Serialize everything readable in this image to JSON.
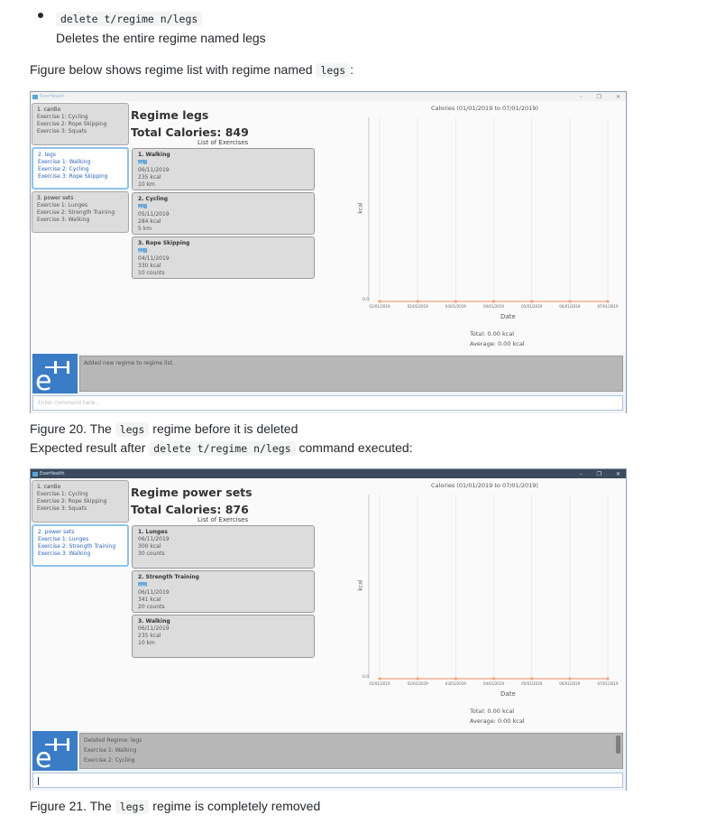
{
  "intro": {
    "command": "delete t/regime n/legs",
    "description": "Deletes the entire regime named legs",
    "figure_intro_prefix": "Figure below shows regime list with regime named",
    "figure_intro_code": "legs",
    "figure_intro_suffix": ":"
  },
  "window1": {
    "app_title": "ExerHealth",
    "regimes": [
      {
        "name": "1.  cardio",
        "exercises": [
          "Exercise 1: Cycling",
          "Exercise 2: Rope Skipping",
          "Exercise 3: Squats"
        ]
      },
      {
        "name": "2.  legs",
        "exercises": [
          "Exercise 1: Walking",
          "Exercise 2: Cycling",
          "Exercise 3: Rope Skipping"
        ]
      },
      {
        "name": "3.  power sets",
        "exercises": [
          "Exercise 1: Lunges",
          "Exercise 2: Strength Training",
          "Exercise 3: Walking"
        ]
      }
    ],
    "regime_title": "Regime legs",
    "total_calories": "Total Calories: 849",
    "list_label": "List of Exercises",
    "exercises": [
      {
        "name": "1.  Walking",
        "tag": "legs",
        "date": "06/11/2019",
        "calories": "235 kcal",
        "quantity": "10 km"
      },
      {
        "name": "2.  Cycling",
        "tag": "legs",
        "date": "05/11/2019",
        "calories": "284 kcal",
        "quantity": "5 km"
      },
      {
        "name": "3.  Rope Skipping",
        "tag": "legs",
        "date": "04/11/2019",
        "calories": "330 kcal",
        "quantity": "10 counts"
      }
    ],
    "result_text": [
      "Added new regime to regime list."
    ],
    "command_placeholder": "Enter command here..."
  },
  "caption1_prefix": "Figure 20. The",
  "caption1_code": "legs",
  "caption1_suffix": "regime before it is deleted",
  "expected_prefix": "Expected result after",
  "expected_code": "delete t/regime n/legs",
  "expected_suffix": "command executed:",
  "window2": {
    "app_title": "ExerHealth",
    "regimes": [
      {
        "name": "1.  cardio",
        "exercises": [
          "Exercise 1: Cycling",
          "Exercise 2: Rope Skipping",
          "Exercise 3: Squats"
        ]
      },
      {
        "name": "2.  power sets",
        "exercises": [
          "Exercise 1: Lunges",
          "Exercise 2: Strength Training",
          "Exercise 3: Walking"
        ]
      }
    ],
    "regime_title": "Regime power sets",
    "total_calories": "Total Calories: 876",
    "list_label": "List of Exercises",
    "exercises": [
      {
        "name": "1.  Lunges",
        "tag": "",
        "date": "06/11/2019",
        "calories": "300 kcal",
        "quantity": "30 counts"
      },
      {
        "name": "2.  Strength Training",
        "tag": "power",
        "date": "06/11/2019",
        "calories": "341 kcal",
        "quantity": "20 counts"
      },
      {
        "name": "3.  Walking",
        "tag": "",
        "date": "06/11/2019",
        "calories": "235 kcal",
        "quantity": "10 km"
      }
    ],
    "result_text": [
      "Deleted Regime: legs",
      "Exercise 1: Walking",
      "Exercise 2: Cycling"
    ],
    "command_placeholder": ""
  },
  "caption2_prefix": "Figure 21. The",
  "caption2_code": "legs",
  "caption2_suffix": "regime is completely removed",
  "chart_data": [
    {
      "type": "line",
      "title": "Calories (01/01/2019 to 07/01/2019)",
      "xlabel": "Date",
      "ylabel": "kcal",
      "categories": [
        "01/01/2019",
        "02/01/2019",
        "03/01/2019",
        "04/01/2019",
        "05/01/2019",
        "06/01/2019",
        "07/01/2019"
      ],
      "series": [
        {
          "values": [
            0,
            0,
            0,
            0,
            0,
            0,
            0
          ]
        }
      ],
      "yticks": [
        "0.0"
      ],
      "grid": true,
      "total": "Total: 0.00 kcal",
      "average": "Average: 0.00 kcal",
      "color": "#f0a47a"
    },
    {
      "type": "line",
      "title": "Calories (01/01/2019 to 07/01/2019)",
      "xlabel": "Date",
      "ylabel": "kcal",
      "categories": [
        "01/01/2019",
        "02/01/2019",
        "03/01/2019",
        "04/01/2019",
        "05/01/2019",
        "06/01/2019",
        "07/01/2019"
      ],
      "series": [
        {
          "values": [
            0,
            0,
            0,
            0,
            0,
            0,
            0
          ]
        }
      ],
      "yticks": [
        "0.0"
      ],
      "grid": true,
      "total": "Total: 0.00 kcal",
      "average": "Average: 0.00 kcal",
      "color": "#f0a47a"
    }
  ]
}
